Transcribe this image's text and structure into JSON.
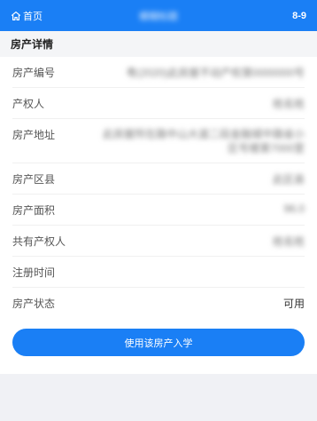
{
  "topbar": {
    "home_label": "首页",
    "title": "模糊标题",
    "page_num": "8-9"
  },
  "section": {
    "title": "房产详情"
  },
  "fields": [
    {
      "label": "房产编号",
      "value": "粤(2020)此房屋不动产权第0000000号"
    },
    {
      "label": "产权人",
      "value": "姓名姓"
    },
    {
      "label": "房产地址",
      "value": "此房屋所在路中山大道二段金融城中路省小区号楼第7000室"
    },
    {
      "label": "房产区县",
      "value": "此区县"
    },
    {
      "label": "房产面积",
      "value": "96.0"
    },
    {
      "label": "共有产权人",
      "value": "姓名姓"
    },
    {
      "label": "注册时间",
      "value": ""
    },
    {
      "label": "房产状态",
      "value": "可用"
    }
  ],
  "action": {
    "button_label": "使用该房产入学"
  },
  "colors": {
    "primary": "#1a7ff5",
    "background": "#f0f1f5"
  }
}
